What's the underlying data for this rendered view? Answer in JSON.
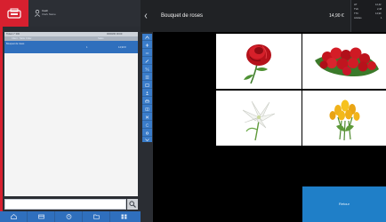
{
  "user": {
    "name": "Cash",
    "subtitle": "Clerk Name"
  },
  "order": {
    "header1_left": "Ticket n° 000",
    "header1_right": "00/00/00 00:00",
    "header2_left": "Client · Table Order",
    "header2_right": "Sales",
    "row_title": "Bouquet de roses",
    "row_qty": "1",
    "row_price": "14,90 €"
  },
  "product_view": {
    "title": "Bouquet de roses",
    "price": "14,90 €"
  },
  "totals": [
    {
      "label": "HT",
      "value": "12,42"
    },
    {
      "label": "TVA",
      "value": "2,48"
    },
    {
      "label": "TTC",
      "value": "14,90"
    },
    {
      "label": "Articles",
      "value": "1"
    }
  ],
  "products": [
    {
      "name": "single red rose"
    },
    {
      "name": "red roses bouquet"
    },
    {
      "name": "white lilies"
    },
    {
      "name": "yellow tulips"
    }
  ],
  "action_button": {
    "label": "Retour"
  },
  "bottom_bar": [
    "home-icon",
    "card-icon",
    "clock-icon",
    "folder-icon",
    "grid-icon"
  ],
  "colors": {
    "accent_red": "#d7202f",
    "accent_blue": "#2f6fbd",
    "action_blue": "#1f7fc8"
  }
}
